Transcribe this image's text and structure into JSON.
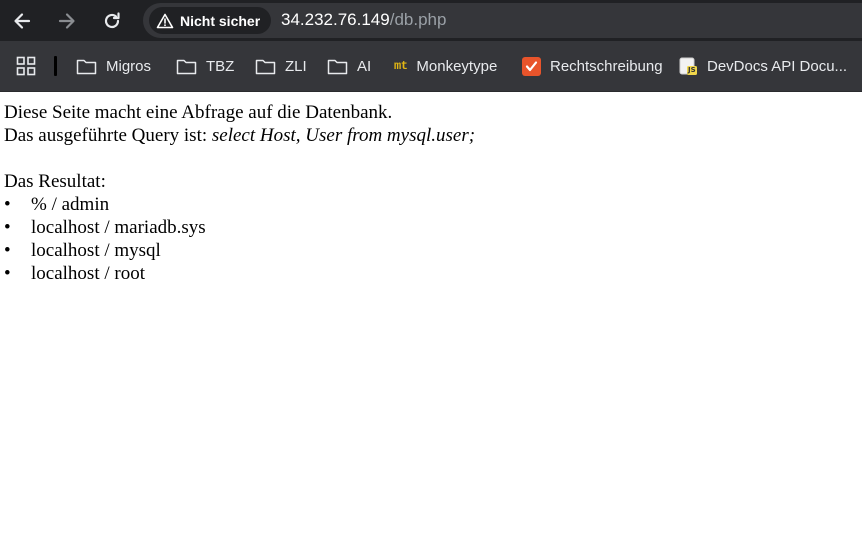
{
  "browser": {
    "security_label": "Nicht sicher",
    "url_host": "34.232.76.149",
    "url_path": "/db.php",
    "bookmarks": [
      {
        "label": "Migros",
        "icon": "folder-icon"
      },
      {
        "label": "TBZ",
        "icon": "folder-icon"
      },
      {
        "label": "ZLI",
        "icon": "folder-icon"
      },
      {
        "label": "AI",
        "icon": "folder-icon"
      },
      {
        "label": "Monkeytype",
        "icon": "monkeytype-icon",
        "logo_text": "mt"
      },
      {
        "label": "Rechtschreibung",
        "icon": "rechtschreibung-icon"
      },
      {
        "label": "DevDocs API Docu...",
        "icon": "devdocs-icon",
        "logo_text": "JS"
      }
    ]
  },
  "page": {
    "intro": "Diese Seite macht eine Abfrage auf die Datenbank.",
    "query_prefix": "Das ausgeführte Query ist: ",
    "query": "select Host, User from mysql.user;",
    "result_heading": "Das Resultat:",
    "bullet": "•",
    "results": [
      "% / admin",
      "localhost / mariadb.sys",
      "localhost / mysql",
      "localhost / root"
    ]
  },
  "colors": {
    "toolbar_bg": "#202124",
    "bookmarks_bg": "#35363a",
    "monkeytype_accent": "#e2b714",
    "rechtschreibung_accent": "#e8542b"
  }
}
